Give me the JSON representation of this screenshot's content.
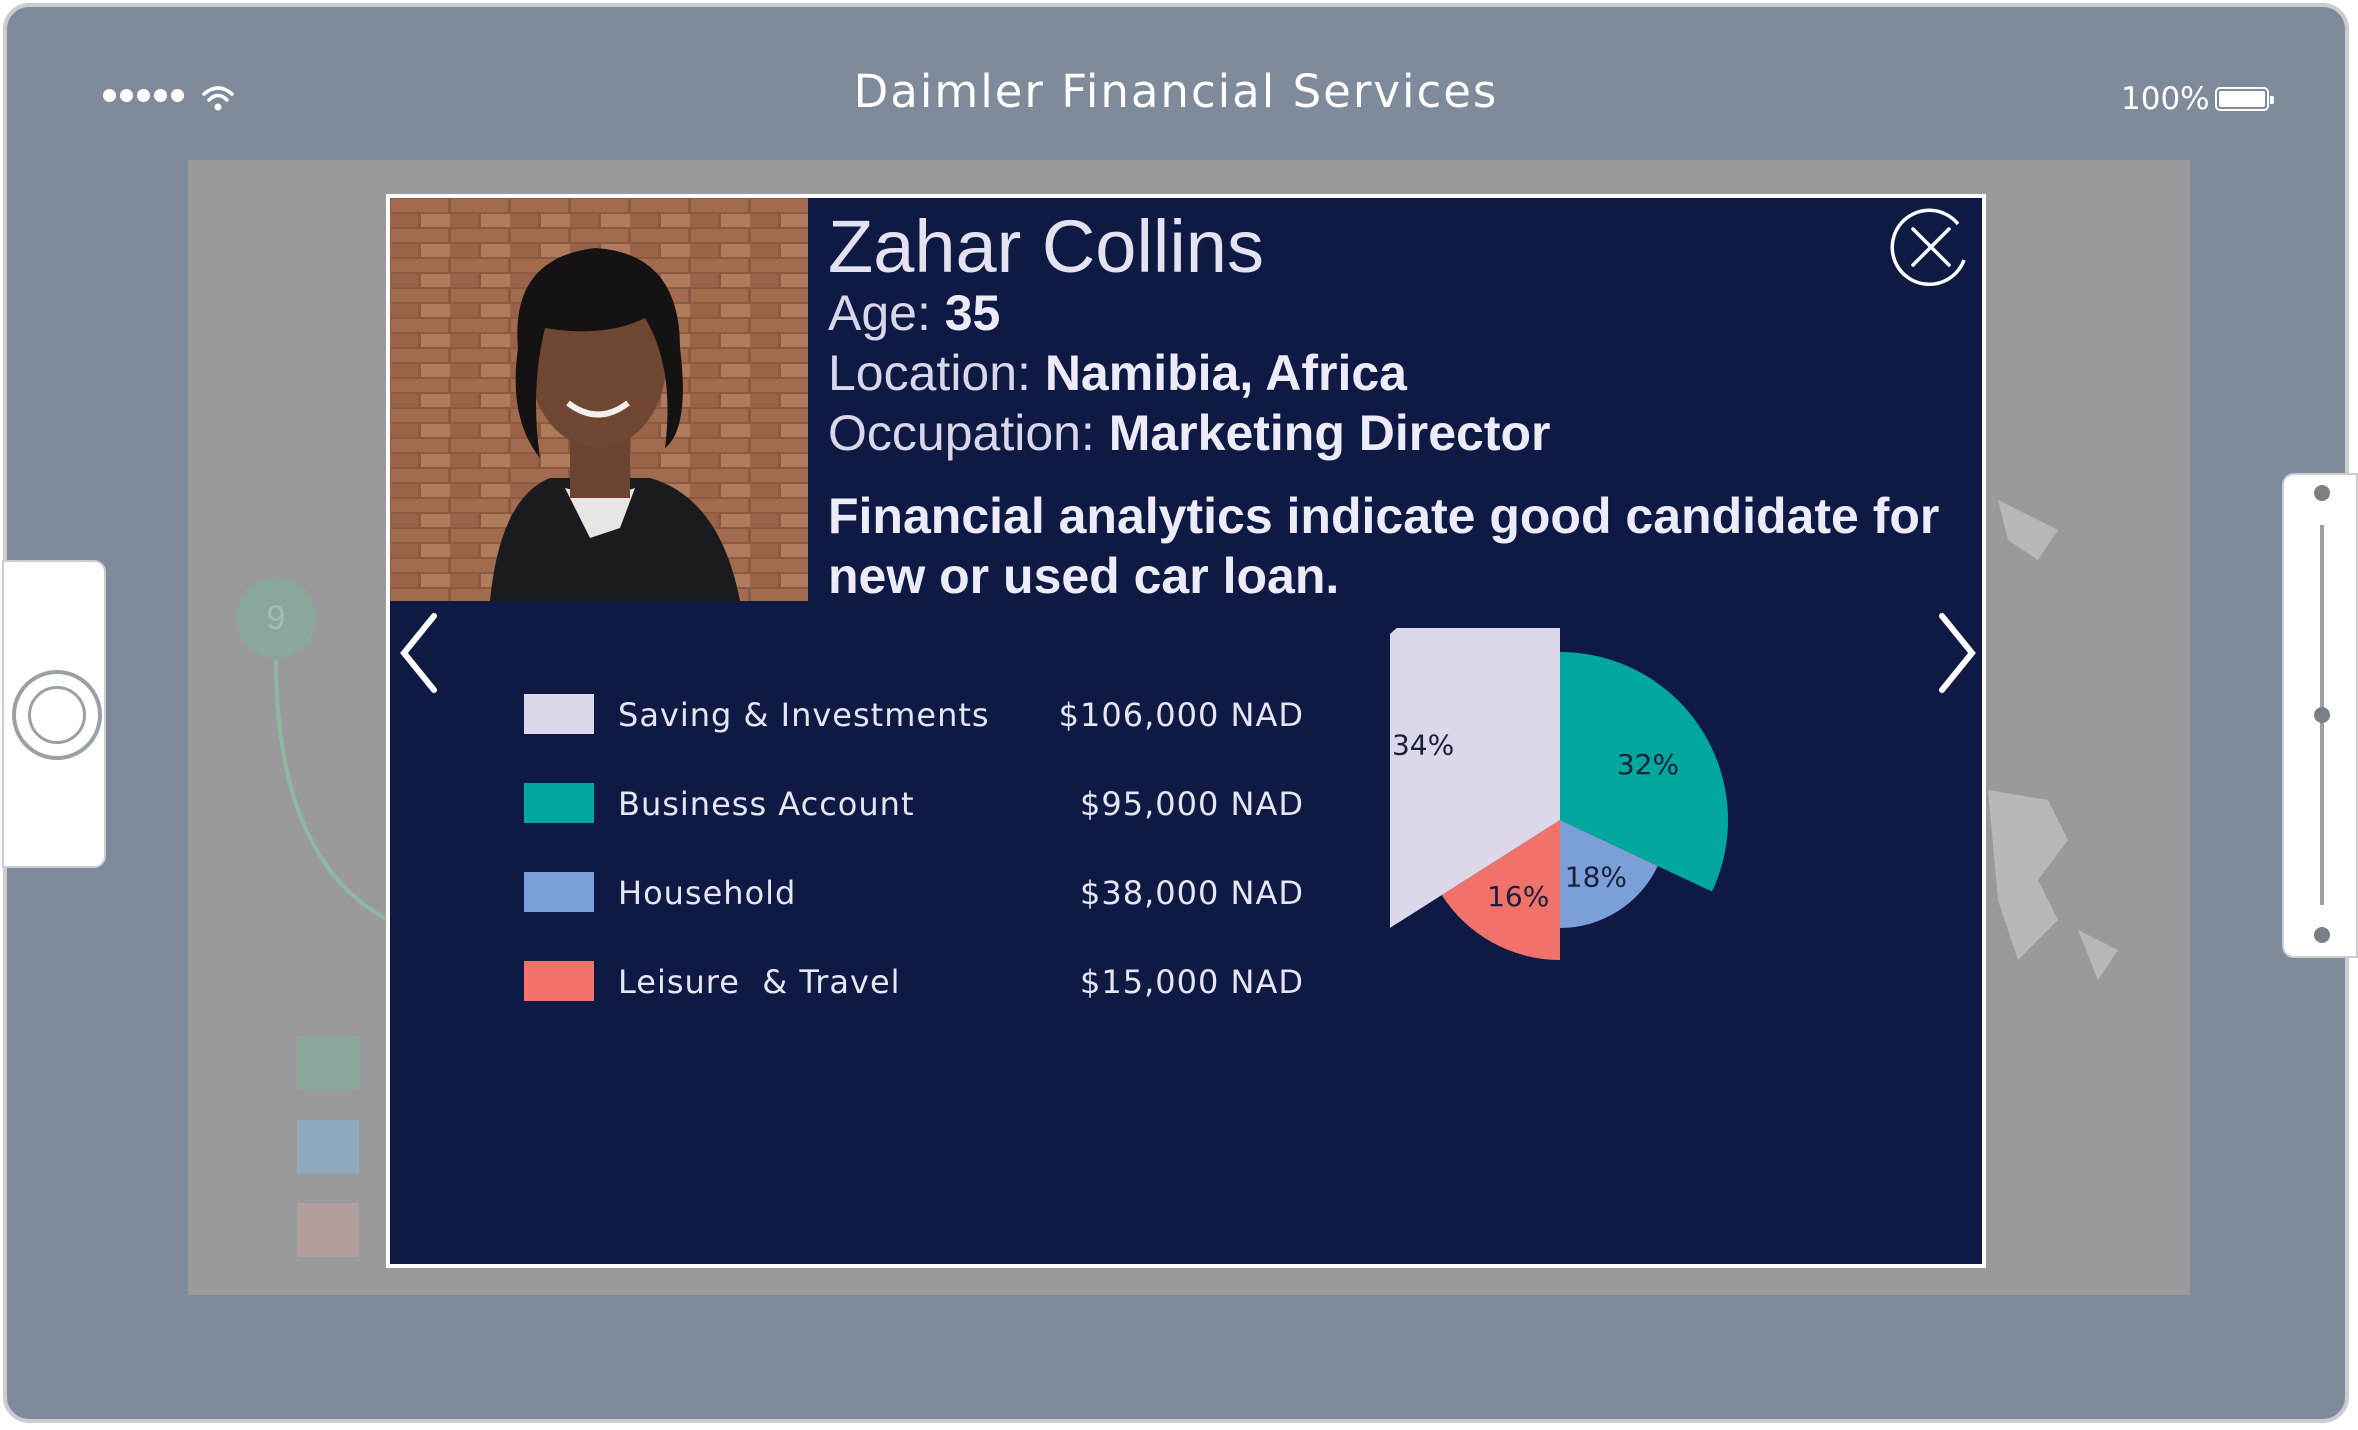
{
  "device": {
    "title": "Daimler Financial Services",
    "battery": "100%"
  },
  "background": {
    "step_number": "9"
  },
  "profile": {
    "name": "Zahar Collins",
    "age_label": "Age: ",
    "age": "35",
    "location_label": "Location: ",
    "location": "Namibia, Africa",
    "occupation_label": "Occupation: ",
    "occupation": "Marketing Director",
    "analytics": "Financial analytics indicate good candidate for new or used car loan."
  },
  "legend": [
    {
      "label": "Saving & Investments",
      "amount": "$106,000 NAD",
      "color": "#dcd8ea"
    },
    {
      "label": "Business Account",
      "amount": "$95,000 NAD",
      "color": "#00a79d"
    },
    {
      "label": "Household",
      "amount": "$38,000 NAD",
      "color": "#7b9fd8"
    },
    {
      "label": "Leisure  & Travel",
      "amount": "$15,000 NAD",
      "color": "#f1726b"
    }
  ],
  "chart_data": {
    "type": "pie",
    "slices": [
      {
        "label": "32%",
        "value": 32,
        "color": "#00a79d"
      },
      {
        "label": "18%",
        "value": 18,
        "color": "#7b9fd8"
      },
      {
        "label": "16%",
        "value": 16,
        "color": "#f1726b"
      },
      {
        "label": "34%",
        "value": 34,
        "color": "#dcd8ea"
      }
    ]
  }
}
